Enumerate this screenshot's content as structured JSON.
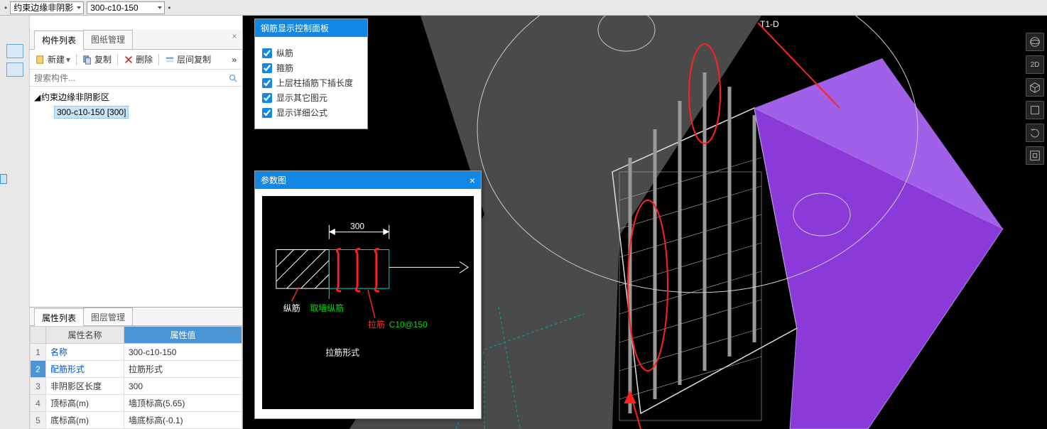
{
  "topbar": {
    "combo_left_marker": "•",
    "combo1": "约束边缘非阴影",
    "combo2": "300-c10-150",
    "combo2_marker": "•"
  },
  "component_panel": {
    "tabs": {
      "list": "构件列表",
      "drawing": "图纸管理"
    },
    "toolbar": {
      "new": "新建",
      "copy": "复制",
      "delete": "删除",
      "floor_copy": "层间复制"
    },
    "search_placeholder": "搜索构件...",
    "tree": {
      "root": "约束边缘非阴影区",
      "item": "300-c10-150 [300]"
    }
  },
  "property_panel": {
    "tabs": {
      "props": "属性列表",
      "layer": "图层管理"
    },
    "headers": {
      "name": "属性名称",
      "value": "属性值"
    },
    "rows": [
      {
        "idx": "1",
        "name": "名称",
        "value": "300-c10-150"
      },
      {
        "idx": "2",
        "name": "配筋形式",
        "value": "拉筋形式"
      },
      {
        "idx": "3",
        "name": "非阴影区长度",
        "value": "300"
      },
      {
        "idx": "4",
        "name": "顶标高(m)",
        "value": "墙顶标高(5.65)"
      },
      {
        "idx": "5",
        "name": "底标高(m)",
        "value": "墙底标高(-0.1)"
      }
    ]
  },
  "rebar_panel": {
    "title": "钢筋显示控制面板",
    "items": [
      "纵筋",
      "箍筋",
      "上层柱插筋下插长度",
      "显示其它图元",
      "显示详细公式"
    ]
  },
  "param_panel": {
    "title": "参数图",
    "dim": "300",
    "label_vertical": "纵筋",
    "label_wall": "取墙纵筋",
    "label_tie": "拉筋",
    "rebar_spec": "C10@150",
    "tie_style": "拉筋形式"
  },
  "viewport": {
    "annotation_label": "T1-D"
  },
  "right_toolbar": {
    "btn_globe": "view-globe",
    "btn_2d": "2D",
    "btn_cube1": "view-iso",
    "btn_cube2": "view-cube",
    "btn_rotate": "rotate",
    "btn_ext": "extents"
  }
}
